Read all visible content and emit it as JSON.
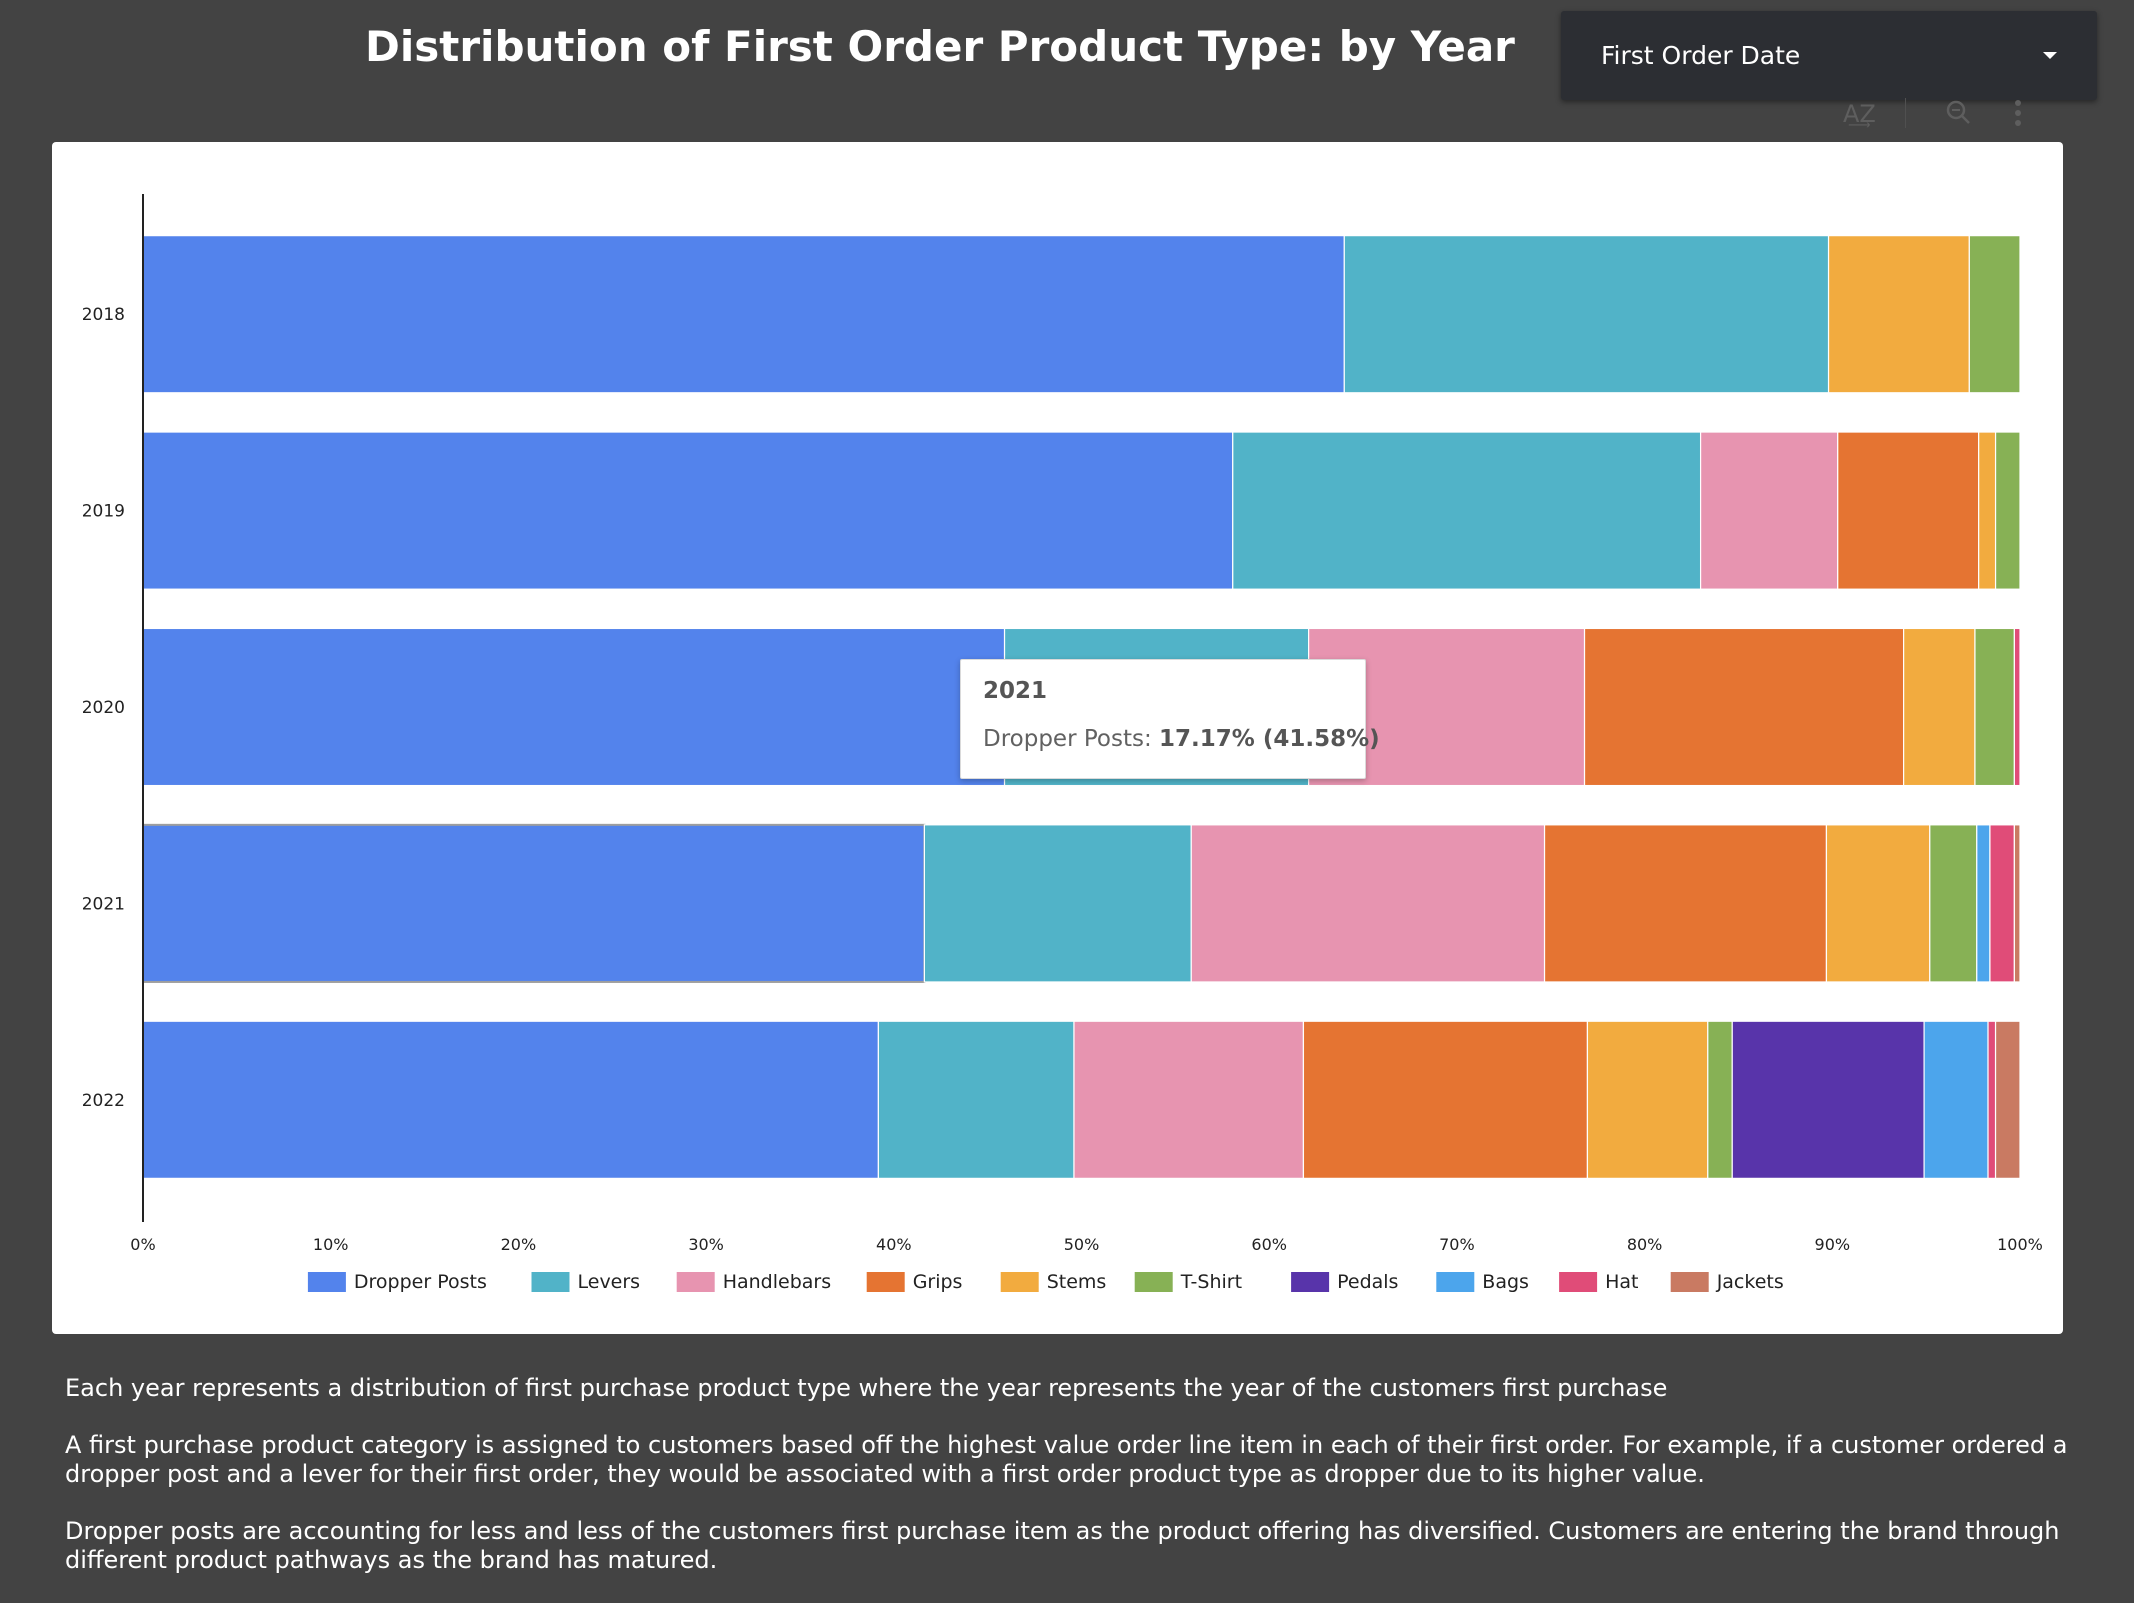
{
  "header": {
    "title": "Distribution of First Order Product Type: by Year"
  },
  "filter": {
    "label": "First Order Date",
    "icon": "chevron-down-icon"
  },
  "toolbar": {
    "icons": [
      "sort-az-icon",
      "zoom-icon",
      "more-vert-icon"
    ],
    "sort_glyph": "A͢Z"
  },
  "tooltip": {
    "title": "2021",
    "series": "Dropper Posts: ",
    "value": "17.17% (41.58%)"
  },
  "notes": {
    "paragraph1": "Each year represents a distribution of first purchase product type where the year represents the year of the customers first purchase",
    "paragraph2": "A first purchase product category is assigned to customers based off the highest value order line item in each of their first order. For example, if a customer ordered a dropper post and a lever for their first order, they would be associated with a first order product type as dropper due to its higher value.",
    "paragraph3": "Dropper posts are accounting for less and less of the customers first purchase item as the product offering has diversified. Customers are entering the brand through different product pathways as the brand has matured."
  },
  "chart_data": {
    "type": "bar",
    "orientation": "horizontal",
    "stacked": "percent",
    "categories": [
      "2018",
      "2019",
      "2020",
      "2021",
      "2022"
    ],
    "x_ticks": [
      "0%",
      "10%",
      "20%",
      "30%",
      "40%",
      "50%",
      "60%",
      "70%",
      "80%",
      "90%",
      "100%"
    ],
    "xlim": [
      0,
      100
    ],
    "legend_position": "bottom",
    "highlighted": {
      "category": "2021",
      "series": "Dropper Posts"
    },
    "series": [
      {
        "name": "Dropper Posts",
        "color": "#5383ec",
        "values": [
          64.0,
          58.0,
          45.9,
          41.58,
          39.1
        ]
      },
      {
        "name": "Levers",
        "color": "#51b3c8",
        "values": [
          25.8,
          24.9,
          16.2,
          14.2,
          10.4
        ]
      },
      {
        "name": "Handlebars",
        "color": "#e794b0",
        "values": [
          0,
          7.3,
          14.7,
          18.8,
          12.2
        ]
      },
      {
        "name": "Grips",
        "color": "#e57432",
        "values": [
          0,
          7.5,
          17.0,
          15.0,
          15.1
        ]
      },
      {
        "name": "Stems",
        "color": "#f2ab3f",
        "values": [
          7.5,
          0.9,
          3.8,
          5.5,
          6.4
        ]
      },
      {
        "name": "T-Shirt",
        "color": "#87b155",
        "values": [
          2.7,
          1.3,
          2.1,
          2.5,
          1.3
        ]
      },
      {
        "name": "Pedals",
        "color": "#5834aa",
        "values": [
          0,
          0,
          0,
          0,
          10.2
        ]
      },
      {
        "name": "Bags",
        "color": "#4ca5ec",
        "values": [
          0,
          0,
          0,
          0.7,
          3.4
        ]
      },
      {
        "name": "Hat",
        "color": "#e04c78",
        "values": [
          0,
          0,
          0.3,
          1.3,
          0.4
        ]
      },
      {
        "name": "Jackets",
        "color": "#c97a62",
        "values": [
          0,
          0,
          0,
          0.3,
          1.3
        ]
      }
    ]
  }
}
